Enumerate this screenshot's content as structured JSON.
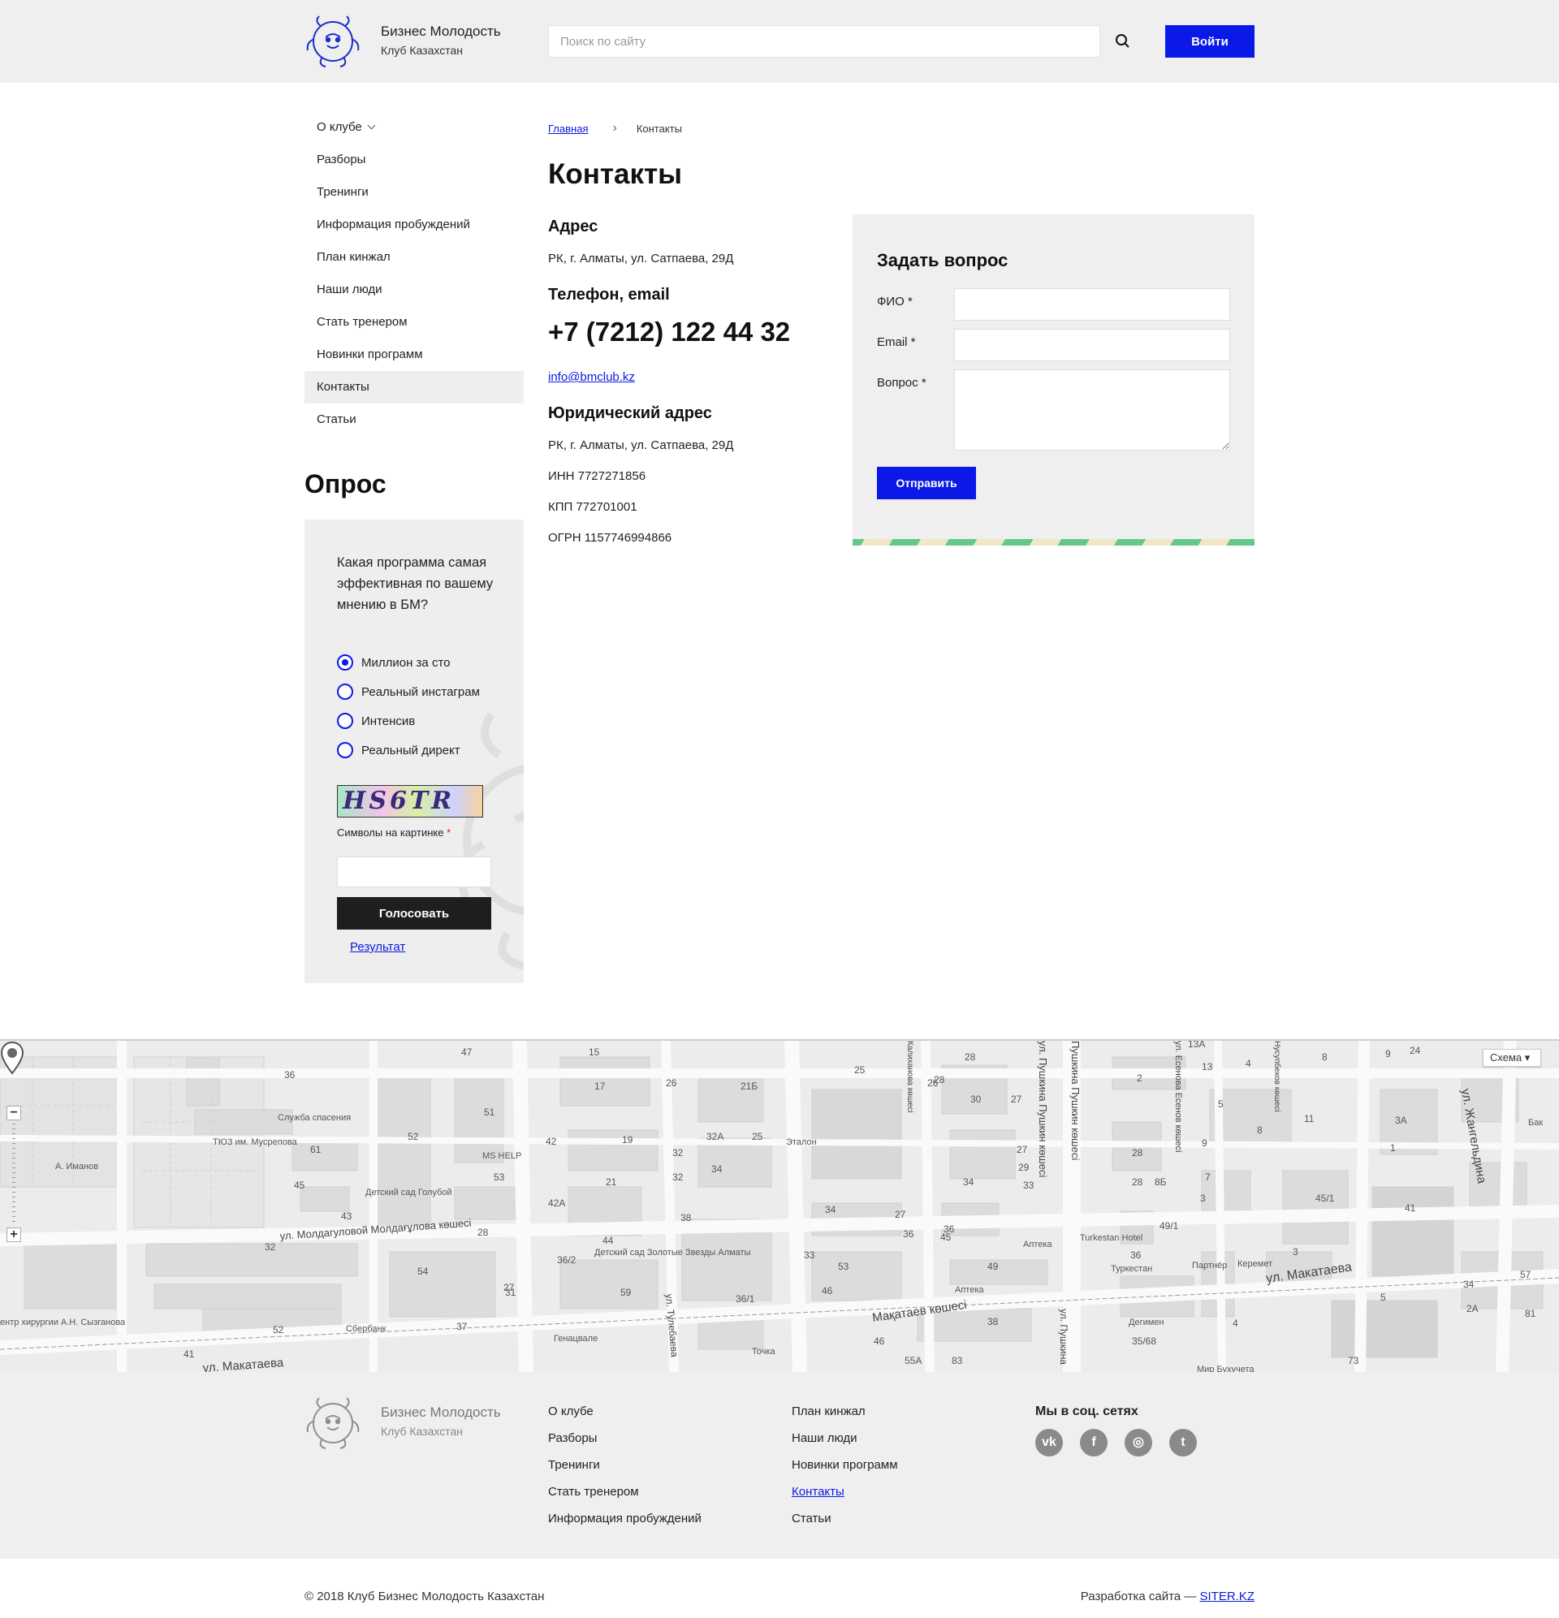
{
  "header": {
    "brand_name": "Бизнес Молодость",
    "brand_sub": "Клуб Казахстан",
    "search_placeholder": "Поиск по сайту",
    "search_icon": "search-icon",
    "login_label": "Войти",
    "accent_color": "#0a19e8"
  },
  "sidebar": {
    "items": [
      {
        "label": "О клубе",
        "has_dropdown": true
      },
      {
        "label": "Разборы"
      },
      {
        "label": "Тренинги"
      },
      {
        "label": "Информация пробуждений"
      },
      {
        "label": "План кинжал"
      },
      {
        "label": "Наши люди"
      },
      {
        "label": "Стать тренером"
      },
      {
        "label": "Новинки программ"
      },
      {
        "label": "Контакты",
        "active": true
      },
      {
        "label": "Статьи"
      }
    ]
  },
  "poll": {
    "title": "Опрос",
    "question": "Какая программа самая эффективная по вашему мнению в БМ?",
    "options": [
      {
        "label": "Миллион за сто",
        "checked": true
      },
      {
        "label": "Реальный инстаграм",
        "checked": false
      },
      {
        "label": "Интенсив",
        "checked": false
      },
      {
        "label": "Реальный директ",
        "checked": false
      }
    ],
    "captcha_text": "HS6TR",
    "captcha_label": "Символы на картинке",
    "required_mark": "*",
    "vote_label": "Голосовать",
    "result_link": "Результат"
  },
  "breadcrumb": {
    "home": "Главная",
    "separator": "›",
    "current": "Контакты"
  },
  "contacts": {
    "page_title": "Контакты",
    "address_title": "Адрес",
    "address": "РК, г. Алматы, ул. Сатпаева, 29Д",
    "phone_title": "Телефон, email",
    "phone": "+7 (7212) 122 44 32",
    "email": "info@bmclub.kz",
    "legal_title": "Юридический адрес",
    "legal_address": "РК, г. Алматы, ул. Сатпаева, 29Д",
    "inn": "ИНН 7727271856",
    "kpp": "КПП 772701001",
    "ogrn": "ОГРН 1157746994866"
  },
  "form": {
    "title": "Задать вопрос",
    "name_label": "ФИО *",
    "email_label": "Email *",
    "question_label": "Вопрос *",
    "submit_label": "Отправить"
  },
  "map": {
    "type_label": "Схема ▾",
    "zoom_in": "+",
    "zoom_out": "−",
    "streets": [
      "ул. Молдагуловой Молдағұлова көшесі",
      "ул. Макатаева",
      "Мақатаев көшесі",
      "ул. Макатаева",
      "ул. Тулебаева",
      "ул. Пушкина Пушкин көшесі",
      "Пушкина Пушкин көшесі",
      "ул. Жангельдина",
      "ул. Есенова Есенов көшесі",
      "Нусупбеков көшесі",
      "Калиханова көшесі",
      "ул. Пушкина"
    ],
    "places": [
      "Служба спасения",
      "ТЮЗ им. Мусрепова",
      "А. Иманов",
      "Детский сад Голубой",
      "MS HELP",
      "Эталон",
      "Детский сад Золотые Звезды Алматы",
      "Аптека",
      "Аптека",
      "Turkestan Hotel",
      "Туркестан",
      "Партнёр",
      "Керемет",
      "Сбербанк",
      "Генацвале",
      "Точка",
      "Дегимен",
      "Мир Бухучета",
      "ентр хирургии А.Н. Сызганова",
      "Бак"
    ],
    "house_numbers": [
      "15",
      "47",
      "36",
      "17",
      "26",
      "21Б",
      "25",
      "28",
      "26",
      "30",
      "27",
      "28",
      "8",
      "9",
      "24",
      "13А",
      "13",
      "4",
      "2",
      "51",
      "52",
      "42",
      "19",
      "32А",
      "25",
      "32",
      "27",
      "28",
      "9",
      "5",
      "3",
      "8",
      "11",
      "3А",
      "1",
      "45",
      "53",
      "21",
      "32",
      "34",
      "29",
      "33",
      "34",
      "28",
      "8Б",
      "7",
      "45/1",
      "41",
      "61",
      "43",
      "28",
      "42А",
      "38",
      "34",
      "27",
      "36",
      "36",
      "49/1",
      "3",
      "45",
      "32",
      "54",
      "27",
      "44",
      "36/2",
      "33",
      "53",
      "49",
      "36",
      "34",
      "57",
      "31",
      "59",
      "36/1",
      "46",
      "38",
      "5",
      "4",
      "2А",
      "81",
      "73",
      "52",
      "37",
      "46",
      "55А",
      "83",
      "35/68",
      "41"
    ]
  },
  "footer": {
    "brand_name": "Бизнес Молодость",
    "brand_sub": "Клуб Казахстан",
    "col1": [
      "О клубе",
      "Разборы",
      "Тренинги",
      "Стать тренером",
      "Информация пробуждений"
    ],
    "col2": [
      "План кинжал",
      "Наши люди",
      "Новинки программ",
      "Контакты",
      "Статьи"
    ],
    "social_title": "Мы в соц. сетях",
    "social": [
      {
        "name": "vk-icon",
        "glyph": "vk"
      },
      {
        "name": "facebook-icon",
        "glyph": "f"
      },
      {
        "name": "instagram-icon",
        "glyph": "◎"
      },
      {
        "name": "twitter-icon",
        "glyph": "t"
      }
    ]
  },
  "bottom": {
    "copyright": "© 2018 Клуб Бизнес Молодость Казахстан",
    "dev_prefix": "Разработка сайта — ",
    "dev_link": "SITER.KZ"
  }
}
